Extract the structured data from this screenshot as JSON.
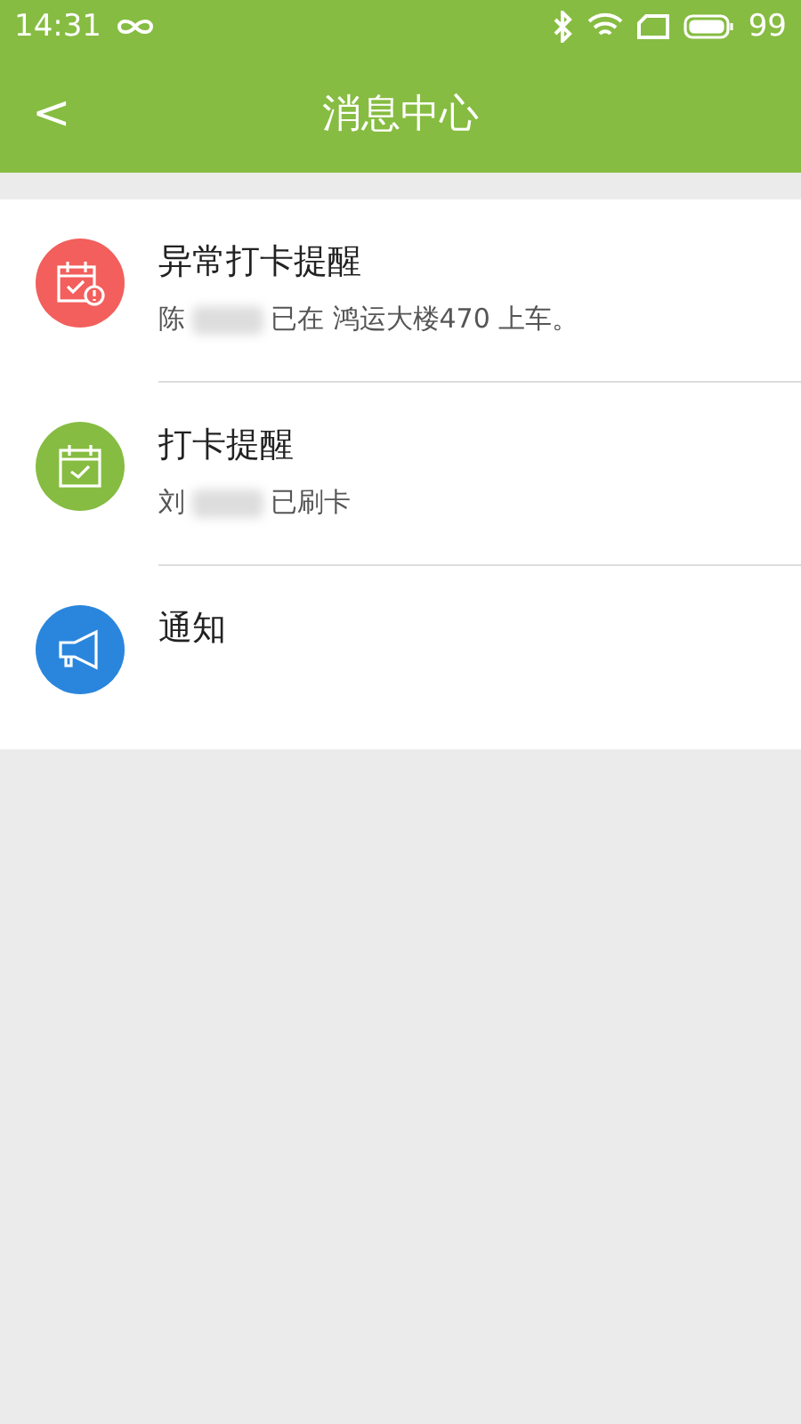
{
  "status_bar": {
    "time": "14:31",
    "battery": "99"
  },
  "header": {
    "back": "<",
    "title": "消息中心"
  },
  "messages": [
    {
      "kind": "alert-calendar",
      "color": "#f25f5c",
      "title": "异常打卡提醒",
      "name": "陈",
      "text": "已在 鸿运大楼470 上车。"
    },
    {
      "kind": "calendar",
      "color": "#86bc41",
      "title": "打卡提醒",
      "name": "刘",
      "text": "已刷卡"
    },
    {
      "kind": "megaphone",
      "color": "#2a86dd",
      "title": "通知"
    }
  ]
}
